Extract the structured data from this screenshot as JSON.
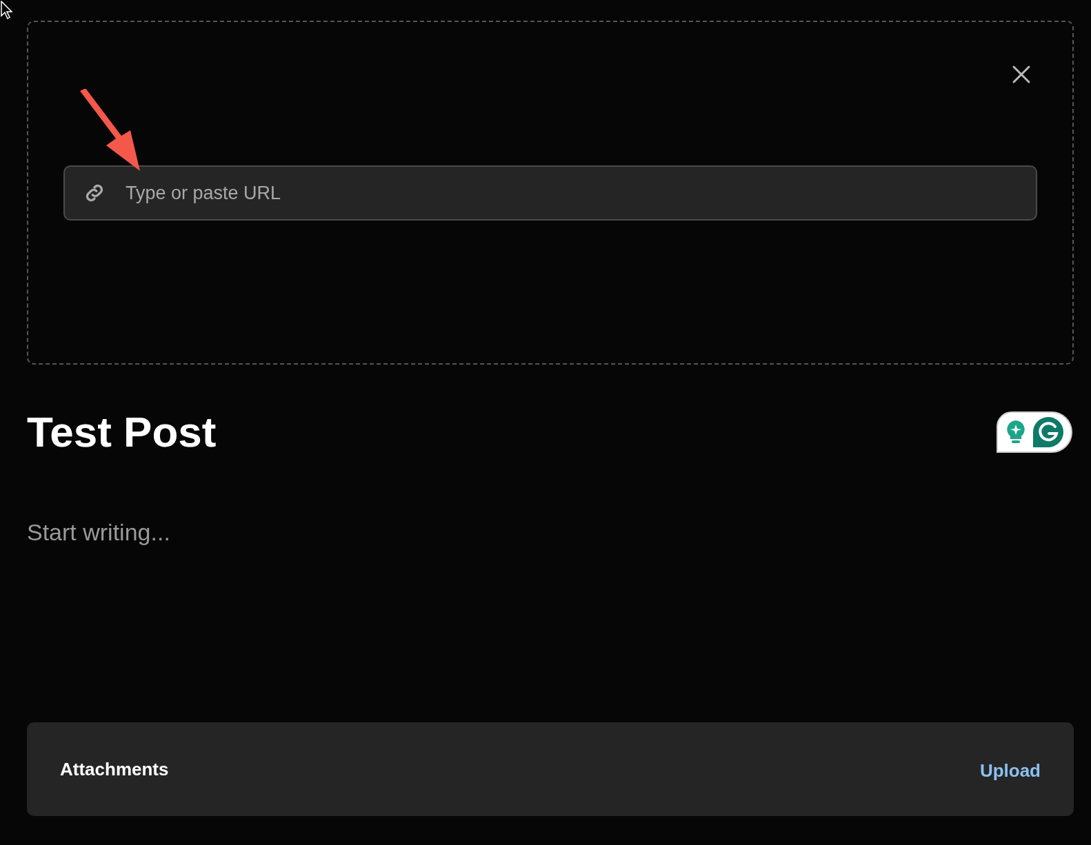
{
  "embed_box": {
    "url_field": {
      "placeholder": "Type or paste URL"
    }
  },
  "post": {
    "title": "Test Post",
    "body": {
      "placeholder": "Start writing..."
    }
  },
  "attachments": {
    "label": "Attachments",
    "upload": "Upload"
  }
}
